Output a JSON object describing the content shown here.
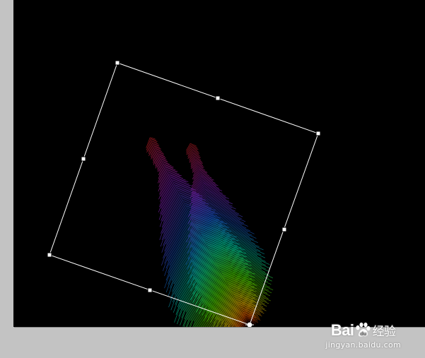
{
  "workspace": {
    "pasteboard_color": "#c3c3c3",
    "canvas_color": "#000000"
  },
  "artwork": {
    "description_icon": "rainbow-feather-icon",
    "gradient_colors": [
      "#ff2a2a",
      "#ff33cc",
      "#8a2be2",
      "#2255ff",
      "#00ccff",
      "#00ff66",
      "#66ff00",
      "#ffee00",
      "#ff8800",
      "#ff2200"
    ]
  },
  "transform": {
    "handle_icon": "transform-handle-icon",
    "center_icon": "crosshair-icon"
  },
  "watermark": {
    "logo_text_left": "Bai",
    "logo_text_right": "经验",
    "url": "jingyan.baidu.com"
  }
}
